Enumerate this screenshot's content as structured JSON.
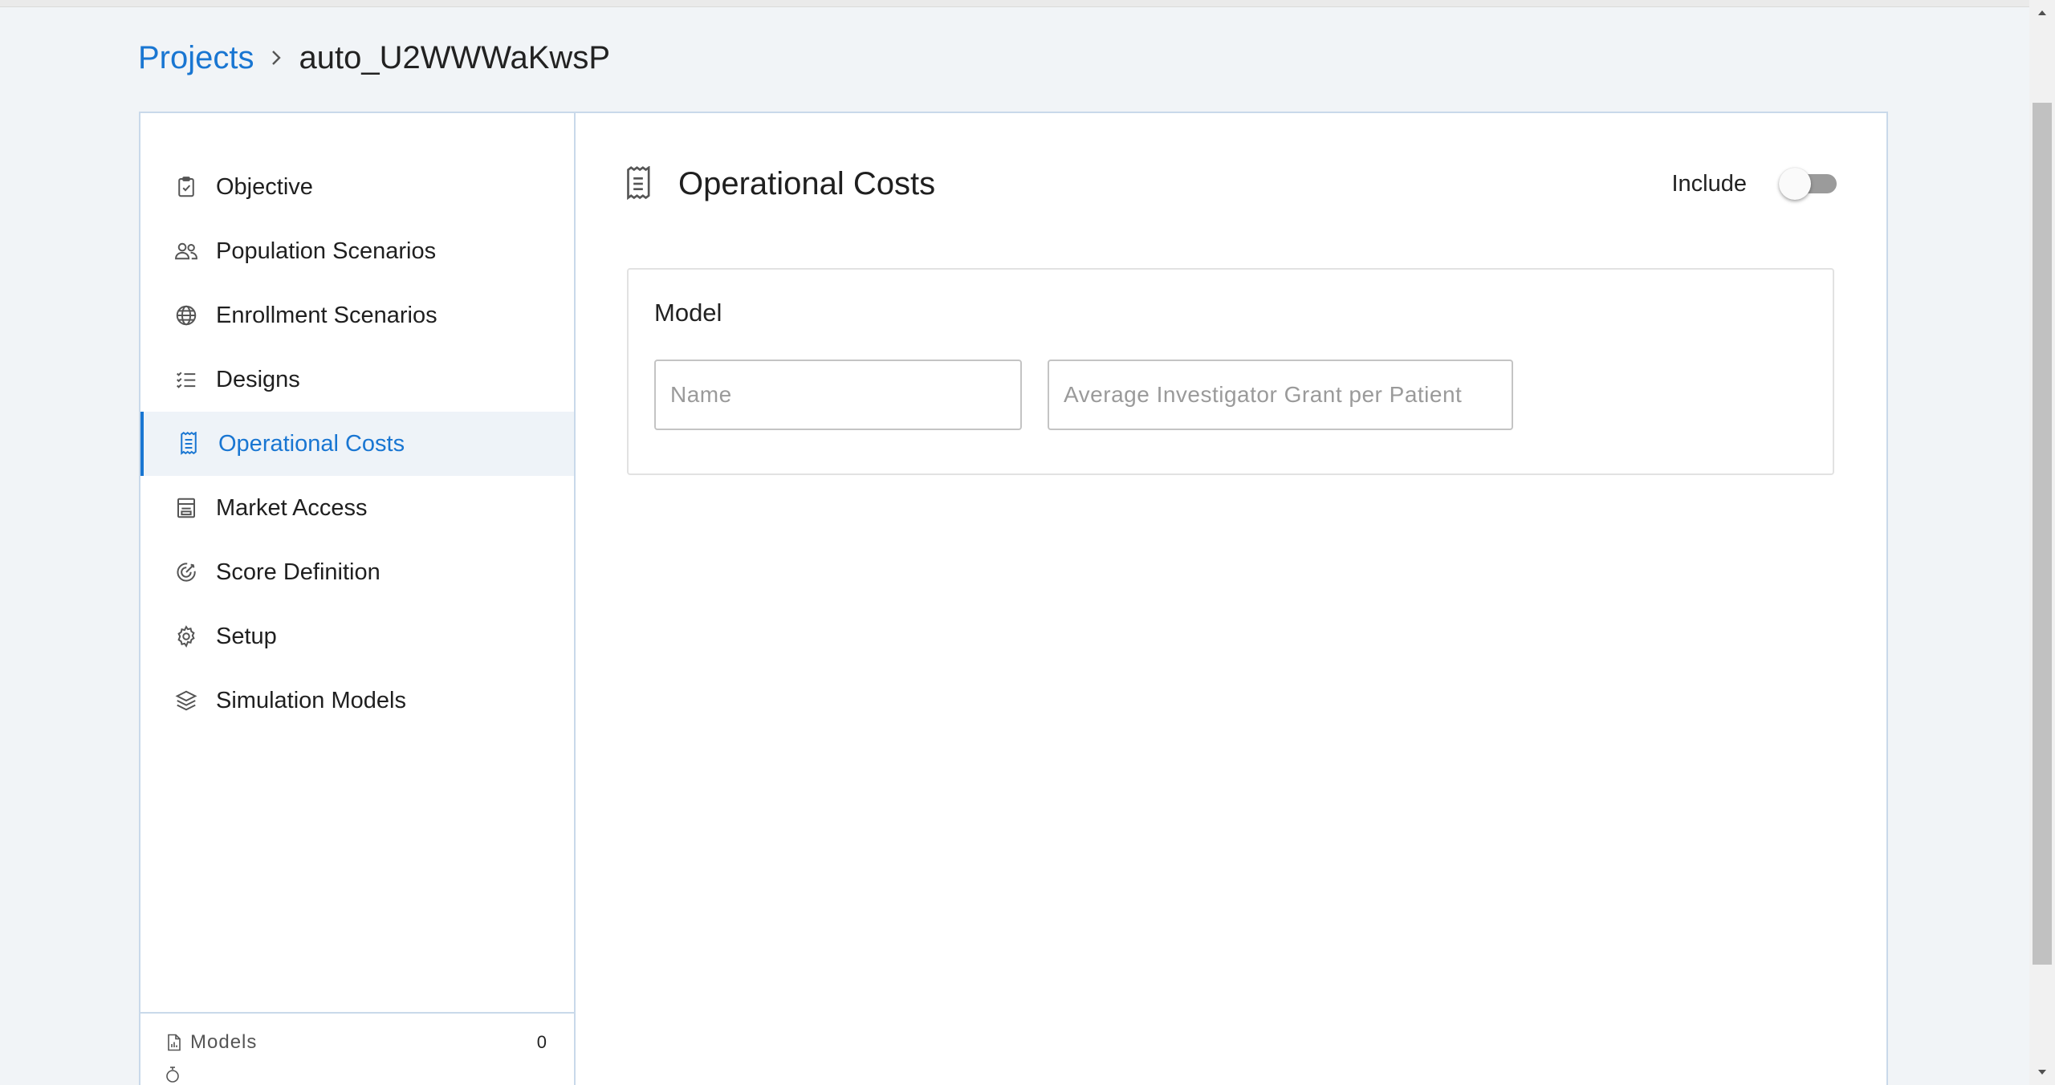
{
  "breadcrumb": {
    "root": "Projects",
    "current": "auto_U2WWWaKwsP"
  },
  "sidebar": {
    "items": [
      {
        "label": "Objective",
        "icon": "clipboard-check-icon"
      },
      {
        "label": "Population Scenarios",
        "icon": "people-icon"
      },
      {
        "label": "Enrollment Scenarios",
        "icon": "globe-icon"
      },
      {
        "label": "Designs",
        "icon": "checklist-icon"
      },
      {
        "label": "Operational Costs",
        "icon": "receipt-icon",
        "active": true
      },
      {
        "label": "Market Access",
        "icon": "document-form-icon"
      },
      {
        "label": "Score Definition",
        "icon": "target-icon"
      },
      {
        "label": "Setup",
        "icon": "gear-icon"
      },
      {
        "label": "Simulation Models",
        "icon": "layers-icon"
      }
    ],
    "footer": {
      "models_label": "Models",
      "models_count": "0",
      "models_icon": "file-chart-icon"
    }
  },
  "content": {
    "title": "Operational Costs",
    "title_icon": "receipt-icon",
    "include_label": "Include",
    "include_on": false,
    "model_panel": {
      "title": "Model",
      "name_field": {
        "value": "",
        "placeholder": "Name"
      },
      "grant_field": {
        "value": "",
        "placeholder": "Average Investigator Grant per Patient"
      }
    }
  },
  "colors": {
    "accent": "#1976d2",
    "page_background": "#f1f4f7",
    "card_border": "#c9d9ea",
    "active_item_background": "#eef3f8",
    "toggle_track_off": "#9b9b9b"
  }
}
